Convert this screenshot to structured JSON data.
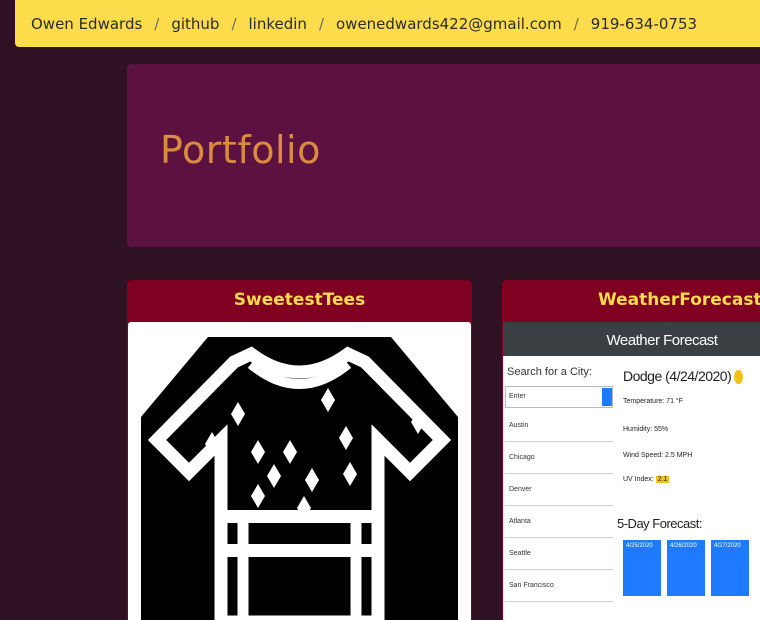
{
  "breadcrumb": {
    "items": [
      {
        "label": "Owen Edwards"
      },
      {
        "label": "github"
      },
      {
        "label": "linkedin"
      },
      {
        "label": "owenedwards422@gmail.com"
      },
      {
        "label": "919-634-0753"
      }
    ],
    "separator": "/"
  },
  "hero": {
    "title": "Portfolio"
  },
  "projects": [
    {
      "title": "SweetestTees"
    },
    {
      "title": "WeatherForecast"
    }
  ],
  "weather_preview": {
    "header": "Weather Forecast",
    "search_label": "Search for a City:",
    "search_value": "Enter",
    "cities": [
      "Austin",
      "Chicago",
      "Denver",
      "Atlanta",
      "Seattle",
      "San Francisco"
    ],
    "city_title": "Dodge (4/24/2020)",
    "temp": "Temperature: 71 °F",
    "humidity": "Humidity: 55%",
    "wind": "Wind Speed: 2.5 MPH",
    "uv_label": "UV Index:",
    "uv_value": "2.1",
    "forecast_title": "5-Day Forecast:",
    "forecast_days": [
      "4/25/2020",
      "4/26/2020",
      "4/27/2020"
    ]
  },
  "colors": {
    "page_bg": "#2e1224",
    "nav_bg": "#fddc4c",
    "jumbotron_bg": "#5d1140",
    "jumbotron_title": "#d98c3f",
    "card_header_bg": "#7f0020",
    "card_title": "#fddc4c"
  }
}
